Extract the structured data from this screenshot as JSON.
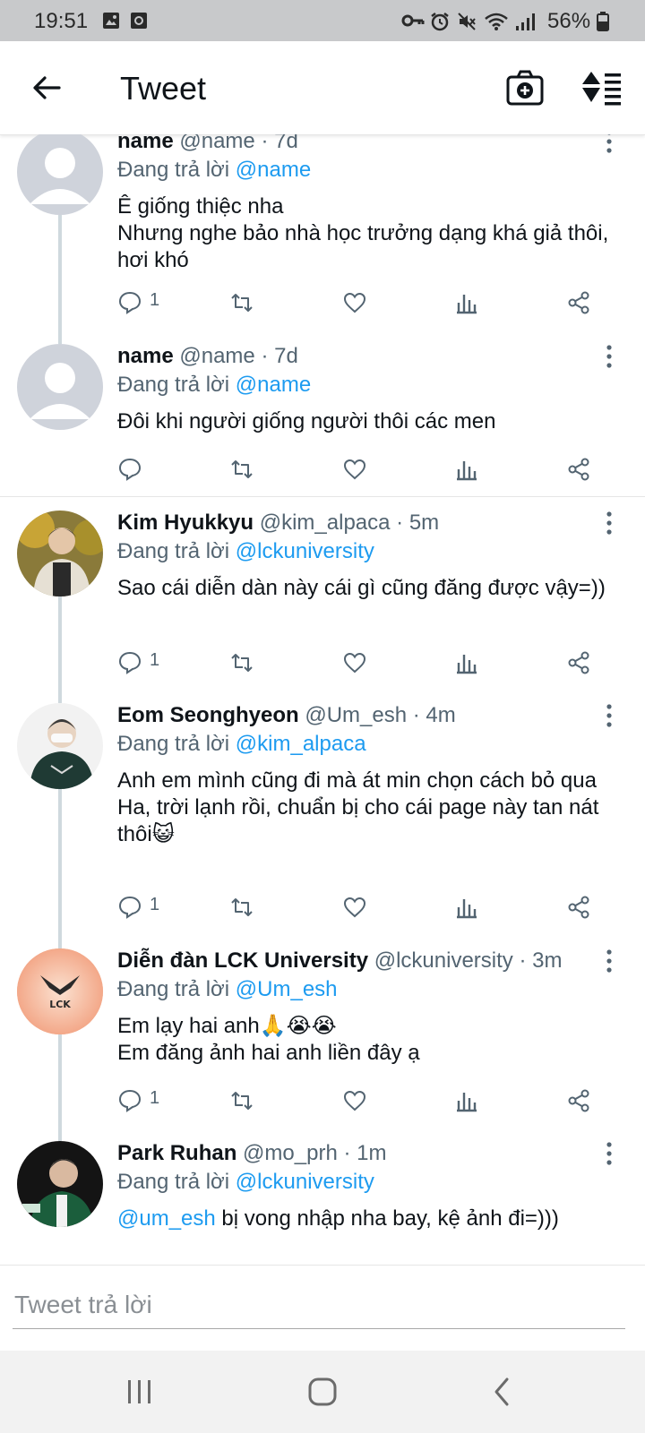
{
  "status_bar": {
    "time": "19:51",
    "battery": "56%",
    "icons": [
      "image-icon",
      "screen-record-icon",
      "key-icon",
      "alarm-icon",
      "mute-icon",
      "wifi-icon",
      "signal-icon",
      "battery-icon"
    ]
  },
  "header": {
    "title": "Tweet",
    "back_icon": "arrow-left-icon",
    "camera_icon": "camera-plus-icon",
    "sort_icon": "sort-icon"
  },
  "tweets": [
    {
      "name": "name",
      "meta": "@name · 7d",
      "reply_prefix": "Đang trả lời ",
      "reply_to": "@name",
      "text": "Ê giống thiệc nha\nNhưng nghe bảo nhà học trưởng dạng khá giả thôi, hơi khó",
      "reply_count": "1"
    },
    {
      "name": "name",
      "meta": "@name · 7d",
      "reply_prefix": "Đang trả lời ",
      "reply_to": "@name",
      "text": "Đôi khi người giống người thôi các men",
      "reply_count": ""
    },
    {
      "name": "Kim Hyukkyu",
      "meta": "@kim_alpaca · 5m",
      "reply_prefix": "Đang trả lời ",
      "reply_to": "@lckuniversity",
      "text": "Sao cái diễn dàn này cái gì cũng đăng được vậy=))",
      "reply_count": "1"
    },
    {
      "name": "Eom Seonghyeon",
      "meta": "@Um_esh · 4m",
      "reply_prefix": "Đang trả lời ",
      "reply_to": "@kim_alpaca",
      "text": "Anh em mình cũng đi mà át min chọn cách bỏ qua\nHa, trời lạnh rồi, chuẩn bị cho cái page này tan nát thôi😺",
      "reply_count": "1"
    },
    {
      "name": "Diễn đàn LCK University",
      "meta": "@lckuniversity · 3m",
      "reply_prefix": "Đang trả lời ",
      "reply_to": "@Um_esh",
      "text": "Em lạy hai anh🙏😭😭\nEm đăng ảnh hai anh liền đây ạ",
      "reply_count": "1",
      "avatar_text": "LCK"
    },
    {
      "name": "Park Ruhan",
      "meta": "@mo_prh · 1m",
      "reply_prefix": "Đang trả lời ",
      "reply_to": "@lckuniversity",
      "text_mention": "@um_esh",
      "text": " bị vong nhập nha bay, kệ ảnh đi=)))"
    }
  ],
  "reply_bar": {
    "placeholder": "Tweet trả lời"
  },
  "nav_bar": {
    "icons": [
      "recent-apps-icon",
      "home-icon",
      "back-icon"
    ]
  },
  "colors": {
    "accent": "#1d9bf0",
    "text": "#0f1419",
    "muted": "#536471",
    "status_bar": "#c8c9cb"
  }
}
